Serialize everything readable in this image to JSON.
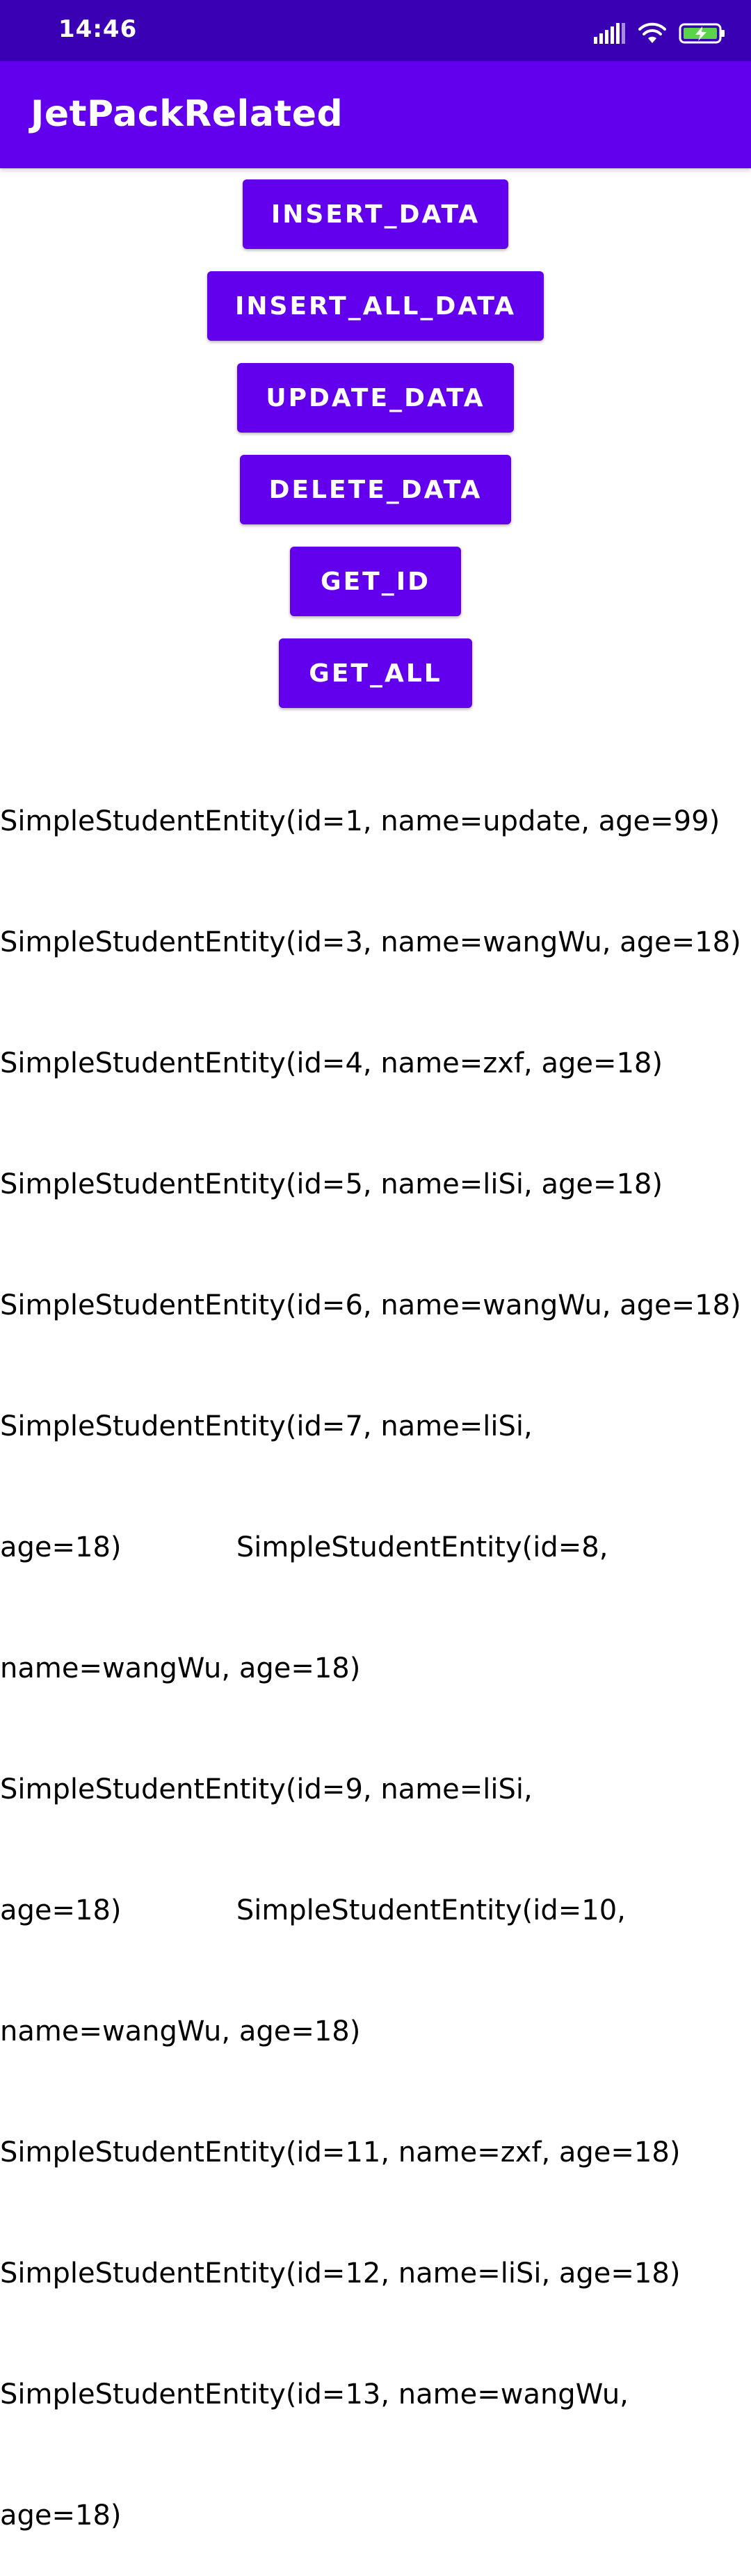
{
  "status_bar": {
    "time": "14:46",
    "icons": [
      "signal-icon",
      "wifi-icon",
      "battery-charging-icon"
    ]
  },
  "app_bar": {
    "title": "JetPackRelated"
  },
  "buttons": {
    "insert_data": "INSERT_DATA",
    "insert_all_data": "INSERT_ALL_DATA",
    "update_data": "UPDATE_DATA",
    "delete_data": "DELETE_DATA",
    "get_id": "GET_ID",
    "get_all": "GET_ALL"
  },
  "results": [
    "SimpleStudentEntity(id=1, name=update, age=99)",
    "SimpleStudentEntity(id=3, name=wangWu, age=18)",
    "SimpleStudentEntity(id=4, name=zxf, age=18)",
    "SimpleStudentEntity(id=5, name=liSi, age=18)",
    "SimpleStudentEntity(id=6, name=wangWu, age=18)",
    "SimpleStudentEntity(id=7, name=liSi,",
    "age=18)             SimpleStudentEntity(id=8,",
    "name=wangWu, age=18)",
    "SimpleStudentEntity(id=9, name=liSi,",
    "age=18)             SimpleStudentEntity(id=10,",
    "name=wangWu, age=18)",
    "SimpleStudentEntity(id=11, name=zxf, age=18)",
    "SimpleStudentEntity(id=12, name=liSi, age=18)",
    "SimpleStudentEntity(id=13, name=wangWu,",
    "age=18)"
  ],
  "colors": {
    "status_bar": "#3a00b3",
    "primary": "#6200ee",
    "on_primary": "#ffffff",
    "battery_fill": "#5bd44a"
  }
}
